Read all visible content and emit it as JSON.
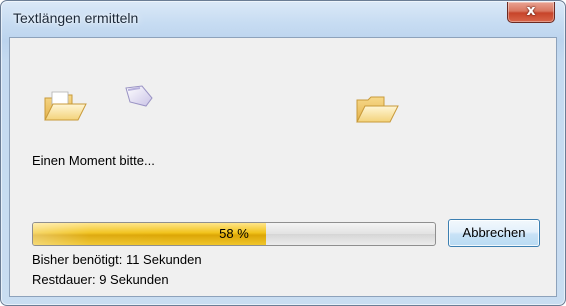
{
  "window": {
    "title": "Textlängen ermitteln",
    "close_label": "x"
  },
  "dialog": {
    "message": "Einen Moment bitte...",
    "progress": {
      "percent": 58,
      "label": "58 %"
    },
    "cancel_label": "Abbrechen",
    "elapsed_text": "Bisher benötigt: 11 Sekunden",
    "remaining_text": "Restdauer: 9 Sekunden"
  },
  "icons": {
    "source_folder": "folder-open-icon",
    "flying_document": "document-icon",
    "target_folder": "folder-open-icon"
  },
  "colors": {
    "progress_fill": "#f1c21a",
    "close_button": "#c7442a",
    "title_bar": "#bcd4ee"
  }
}
